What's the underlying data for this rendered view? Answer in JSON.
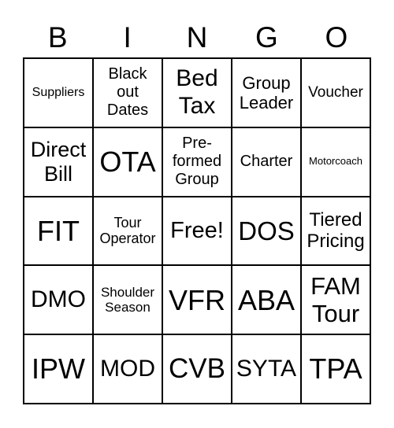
{
  "header": [
    "B",
    "I",
    "N",
    "G",
    "O"
  ],
  "cells": [
    "Suppliers",
    "Black out Dates",
    "Bed Tax",
    "Group Leader",
    "Voucher",
    "Direct Bill",
    "OTA",
    "Pre-formed Group",
    "Charter",
    "Motorcoach",
    "FIT",
    "Tour Operator",
    "Free!",
    "DOS",
    "Tiered Pricing",
    "DMO",
    "Shoulder Season",
    "VFR",
    "ABA",
    "FAM Tour",
    "IPW",
    "MOD",
    "CVB",
    "SYTA",
    "TPA"
  ]
}
